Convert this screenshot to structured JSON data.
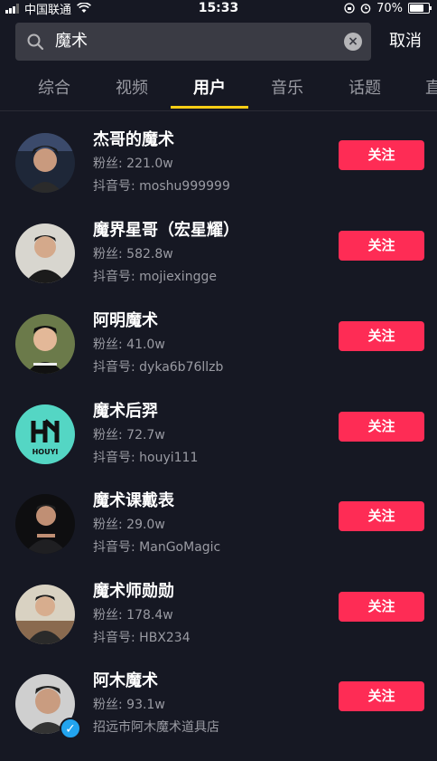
{
  "status_bar": {
    "carrier": "中国联通",
    "time": "15:33",
    "battery": "70%"
  },
  "search": {
    "query": "魔术",
    "cancel_label": "取消"
  },
  "tabs": [
    {
      "label": "综合"
    },
    {
      "label": "视频"
    },
    {
      "label": "用户"
    },
    {
      "label": "音乐"
    },
    {
      "label": "话题"
    },
    {
      "label": "直"
    }
  ],
  "active_tab": "用户",
  "follow_label": "关注",
  "users": [
    {
      "name": "杰哥的魔术",
      "fans": "粉丝: 221.0w",
      "account": "抖音号: moshu999999"
    },
    {
      "name": "魔界星哥（宏星耀）",
      "fans": "粉丝: 582.8w",
      "account": "抖音号: mojiexingge"
    },
    {
      "name": "阿明魔术",
      "fans": "粉丝: 41.0w",
      "account": "抖音号: dyka6b76llzb"
    },
    {
      "name": "魔术后羿",
      "fans": "粉丝: 72.7w",
      "account": "抖音号: houyi111",
      "avatar_text": "HOUYI"
    },
    {
      "name": "魔术课戴表",
      "fans": "粉丝: 29.0w",
      "account": "抖音号: ManGoMagic"
    },
    {
      "name": "魔术师勋勋",
      "fans": "粉丝: 178.4w",
      "account": "抖音号: HBX234"
    },
    {
      "name": "阿木魔术",
      "fans": "粉丝: 93.1w",
      "account": "招远市阿木魔术道具店",
      "verified": true
    }
  ],
  "colors": {
    "background": "#161823",
    "accent": "#fe2c55",
    "tab_indicator": "#face15",
    "verified": "#22a4ef"
  }
}
